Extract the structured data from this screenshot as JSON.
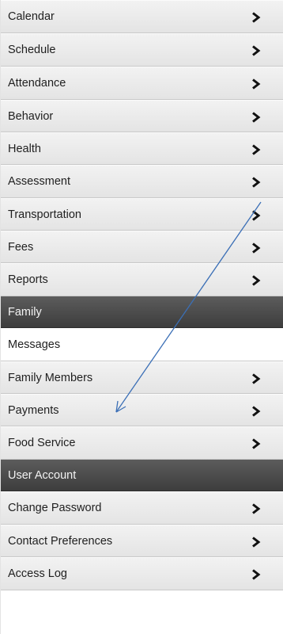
{
  "menu": {
    "items": [
      {
        "label": "Calendar",
        "chevron": "chevron-right-icon"
      },
      {
        "label": "Schedule",
        "chevron": "chevron-right-icon"
      },
      {
        "label": "Attendance",
        "chevron": "chevron-right-icon"
      },
      {
        "label": "Behavior",
        "chevron": "chevron-right-icon"
      },
      {
        "label": "Health",
        "chevron": "chevron-right-icon"
      },
      {
        "label": "Assessment",
        "chevron": "chevron-right-icon"
      },
      {
        "label": "Transportation",
        "chevron": "chevron-right-icon"
      },
      {
        "label": "Fees",
        "chevron": "chevron-right-icon"
      },
      {
        "label": "Reports",
        "chevron": "chevron-right-icon"
      }
    ],
    "family_header": "Family",
    "family_items": [
      {
        "label": "Messages",
        "active": true
      },
      {
        "label": "Family Members",
        "chevron": "chevron-right-icon"
      },
      {
        "label": "Payments",
        "chevron": "chevron-right-icon"
      },
      {
        "label": "Food Service",
        "chevron": "chevron-right-icon"
      }
    ],
    "account_header": "User Account",
    "account_items": [
      {
        "label": "Change Password",
        "chevron": "chevron-right-icon"
      },
      {
        "label": "Contact Preferences",
        "chevron": "chevron-right-icon"
      },
      {
        "label": "Access Log",
        "chevron": "chevron-right-icon"
      }
    ]
  },
  "colors": {
    "item_bg": "#ebebeb",
    "header_bg": "#4a4a4a",
    "active_bg": "#ffffff",
    "annotation_arrow": "#3b6fb6"
  }
}
